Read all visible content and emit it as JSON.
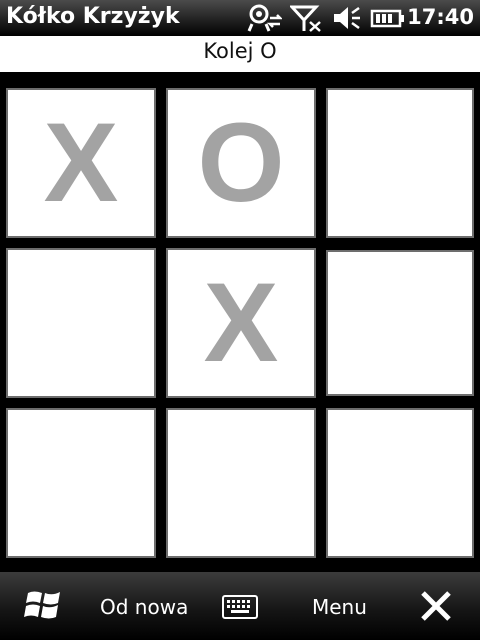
{
  "app": {
    "title": "Kółko Krzyżyk",
    "clock": "17:40"
  },
  "status_icons": [
    "sync-icon",
    "signal-off-icon",
    "volume-muted-icon",
    "battery-icon"
  ],
  "turn": {
    "text": "Kolej O"
  },
  "board": {
    "cells": [
      "X",
      "O",
      "",
      "",
      "X",
      "",
      "",
      "",
      ""
    ]
  },
  "softkeys": {
    "left_label": "Od nowa",
    "right_label": "Menu"
  },
  "colors": {
    "mark": "#a3a3a3",
    "cell_bg": "#ffffff",
    "grid_bg": "#000000"
  }
}
